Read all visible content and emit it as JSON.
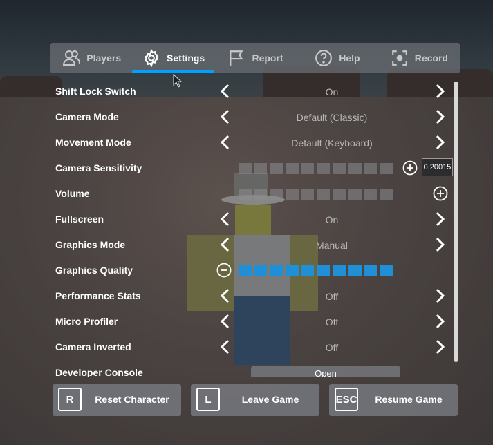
{
  "tabs": [
    {
      "label": "Players",
      "icon": "players-icon",
      "active": false
    },
    {
      "label": "Settings",
      "icon": "gear-icon",
      "active": true
    },
    {
      "label": "Report",
      "icon": "flag-icon",
      "active": false
    },
    {
      "label": "Help",
      "icon": "question-icon",
      "active": false
    },
    {
      "label": "Record",
      "icon": "record-icon",
      "active": false
    }
  ],
  "settings": {
    "shift_lock": {
      "label": "Shift Lock Switch",
      "value": "On"
    },
    "camera_mode": {
      "label": "Camera Mode",
      "value": "Default (Classic)"
    },
    "movement_mode": {
      "label": "Movement Mode",
      "value": "Default (Keyboard)"
    },
    "camera_sensitivity": {
      "label": "Camera Sensitivity",
      "value": "0.20015",
      "filled_segments": 0,
      "total_segments": 10
    },
    "volume": {
      "label": "Volume",
      "filled_segments": 0,
      "total_segments": 10
    },
    "fullscreen": {
      "label": "Fullscreen",
      "value": "On"
    },
    "graphics_mode": {
      "label": "Graphics Mode",
      "value": "Manual"
    },
    "graphics_quality": {
      "label": "Graphics Quality",
      "filled_segments": 10,
      "total_segments": 10
    },
    "performance_stats": {
      "label": "Performance Stats",
      "value": "Off"
    },
    "micro_profiler": {
      "label": "Micro Profiler",
      "value": "Off"
    },
    "camera_inverted": {
      "label": "Camera Inverted",
      "value": "Off"
    },
    "developer_console": {
      "label": "Developer Console",
      "button": "Open"
    }
  },
  "actions": {
    "reset": {
      "key": "R",
      "label": "Reset Character"
    },
    "leave": {
      "key": "L",
      "label": "Leave Game"
    },
    "resume": {
      "key": "ESC",
      "label": "Resume Game"
    }
  },
  "colors": {
    "accent": "#00a2ff",
    "slider_on": "#1f8fd6"
  }
}
